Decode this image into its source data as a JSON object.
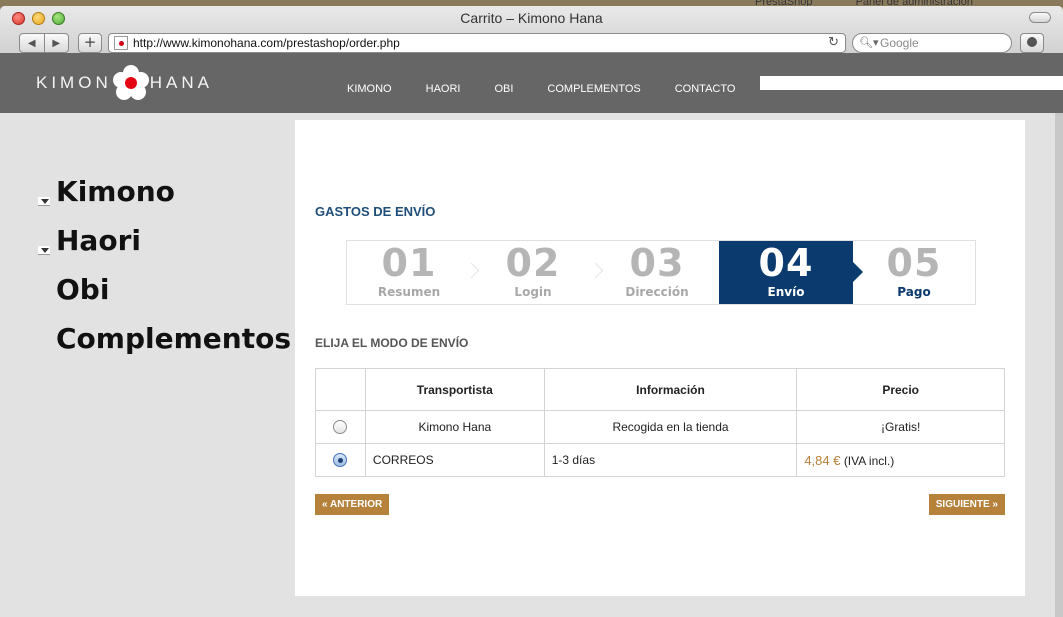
{
  "desktop": {
    "bits": [
      "PrestaShop",
      "Panel de administración"
    ]
  },
  "window": {
    "title": "Carrito – Kimono Hana",
    "url": "http://www.kimonohana.com/prestashop/order.php",
    "search_placeholder": "Google"
  },
  "header": {
    "logo_left": "KIMON",
    "logo_right": "HANA",
    "nav": [
      "KIMONO",
      "HAORI",
      "OBI",
      "COMPLEMENTOS",
      "CONTACTO"
    ]
  },
  "sidebar": {
    "items": [
      {
        "label": "Kimono",
        "expandable": true
      },
      {
        "label": "Haori",
        "expandable": true
      },
      {
        "label": "Obi",
        "expandable": false
      },
      {
        "label": "Complementos",
        "expandable": false
      }
    ]
  },
  "checkout": {
    "title": "GASTOS DE ENVÍO",
    "steps": [
      {
        "num": "01",
        "label": "Resumen"
      },
      {
        "num": "02",
        "label": "Login"
      },
      {
        "num": "03",
        "label": "Dirección"
      },
      {
        "num": "04",
        "label": "Envío"
      },
      {
        "num": "05",
        "label": "Pago"
      }
    ],
    "active_step": 4,
    "subtitle": "ELIJA EL MODO DE ENVÍO",
    "table": {
      "headers": [
        "",
        "Transportista",
        "Información",
        "Precio"
      ],
      "rows": [
        {
          "selected": false,
          "carrier": "Kimono Hana",
          "info": "Recogida en la tienda",
          "price": "¡Gratis!",
          "price_suffix": ""
        },
        {
          "selected": true,
          "carrier": "CORREOS",
          "info": "1-3 días",
          "price": "4,84 €",
          "price_suffix": "(IVA incl.)"
        }
      ]
    },
    "prev_label": "« ANTERIOR",
    "next_label": "SIGUIENTE »"
  },
  "colors": {
    "active_step": "#0b3a6e",
    "accent": "#b5813b",
    "header_bg": "#666666"
  }
}
